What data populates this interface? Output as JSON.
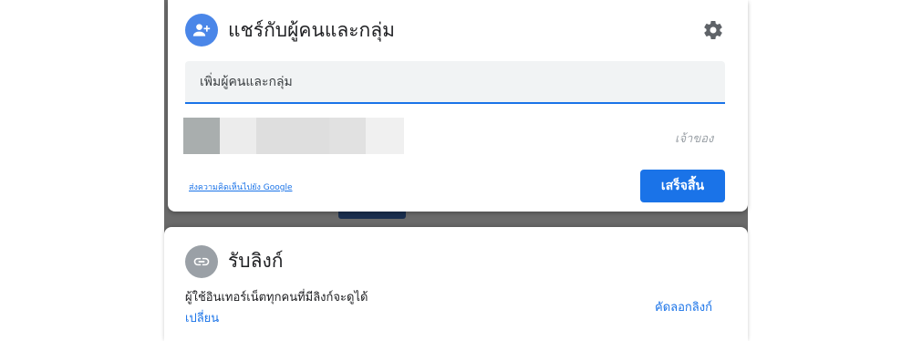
{
  "share": {
    "title": "แชร์กับผู้คนและกลุ่ม",
    "add_placeholder": "เพิ่มผู้คนและกลุ่ม",
    "owner_role": "เจ้าของ",
    "feedback_link": "ส่งความคิดเห็นไปยัง Google",
    "done_button": "เสร็จสิ้น",
    "icons": {
      "header": "person-add-icon",
      "settings": "gear-icon"
    },
    "colors": {
      "accent": "#1a73e8",
      "header_avatar": "#4a86e8"
    }
  },
  "link": {
    "title": "รับลิงก์",
    "description": "ผู้ใช้อินเทอร์เน็ตทุกคนที่มีลิงก์จะดูได้",
    "change_label": "เปลี่ยน",
    "copy_label": "คัดลอกลิงก์",
    "icons": {
      "header": "link-icon"
    },
    "colors": {
      "header_avatar": "#9aa0a6"
    }
  }
}
